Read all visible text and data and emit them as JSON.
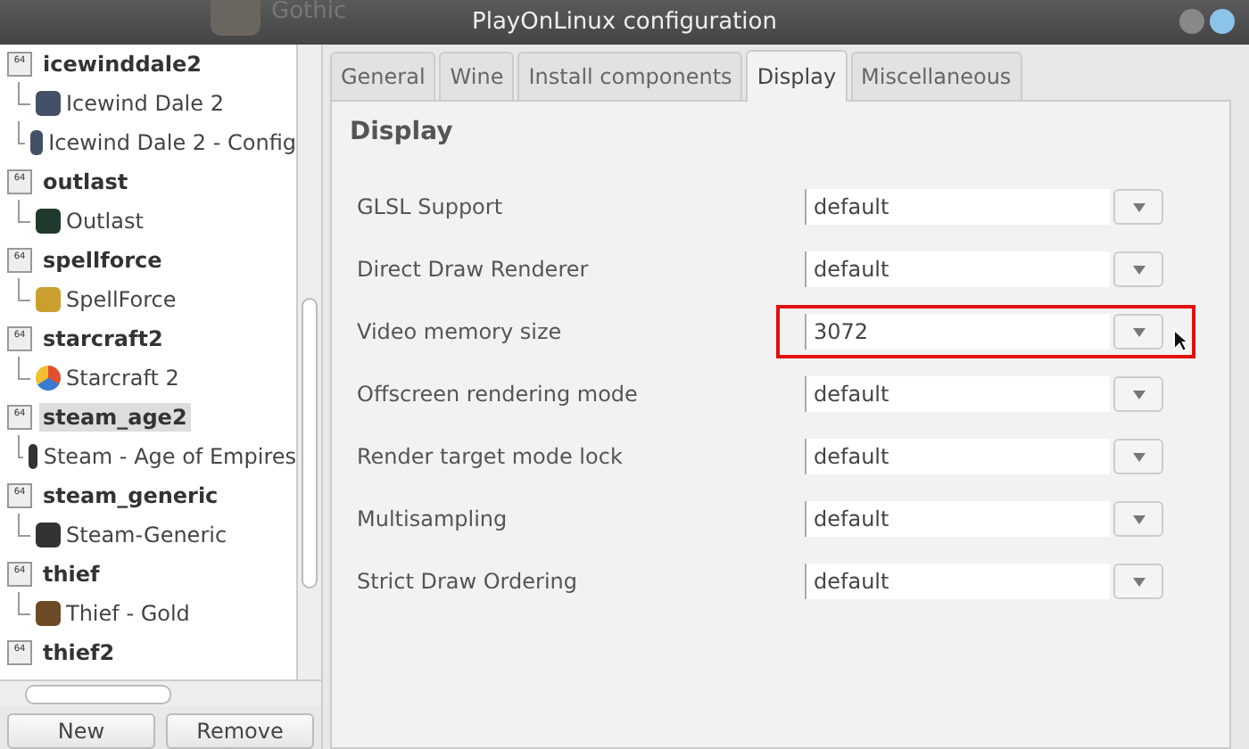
{
  "background_window": {
    "label": "Gothic"
  },
  "window": {
    "title": "PlayOnLinux configuration"
  },
  "tree": [
    {
      "label": "icewinddale2",
      "badge": "64",
      "selected": false,
      "children": [
        {
          "label": "Icewind Dale 2",
          "kind": "gear"
        },
        {
          "label": "Icewind Dale 2 - Config",
          "kind": "gear"
        }
      ]
    },
    {
      "label": "outlast",
      "badge": "64",
      "selected": false,
      "children": [
        {
          "label": "Outlast",
          "kind": "dark"
        }
      ]
    },
    {
      "label": "spellforce",
      "badge": "64",
      "selected": false,
      "children": [
        {
          "label": "SpellForce",
          "kind": "yellow"
        }
      ]
    },
    {
      "label": "starcraft2",
      "badge": "64",
      "selected": false,
      "children": [
        {
          "label": "Starcraft 2",
          "kind": "flower"
        }
      ]
    },
    {
      "label": "steam_age2",
      "badge": "64",
      "selected": true,
      "children": [
        {
          "label": "Steam - Age of Empires",
          "kind": "steam"
        }
      ]
    },
    {
      "label": "steam_generic",
      "badge": "64",
      "selected": false,
      "children": [
        {
          "label": "Steam-Generic",
          "kind": "steam"
        }
      ]
    },
    {
      "label": "thief",
      "badge": "64",
      "selected": false,
      "children": [
        {
          "label": "Thief - Gold",
          "kind": "brown"
        }
      ]
    },
    {
      "label": "thief2",
      "badge": "64",
      "selected": false
    }
  ],
  "buttons": [
    "New",
    "Remove"
  ],
  "tabs": [
    {
      "label": "General",
      "selected": false
    },
    {
      "label": "Wine",
      "selected": false
    },
    {
      "label": "Install components",
      "selected": false
    },
    {
      "label": "Display",
      "selected": true
    },
    {
      "label": "Miscellaneous",
      "selected": false
    }
  ],
  "panel": {
    "heading": "Display",
    "settings": [
      {
        "label": "GLSL Support",
        "value": "default",
        "highlighted": false
      },
      {
        "label": "Direct Draw Renderer",
        "value": "default",
        "highlighted": false
      },
      {
        "label": "Video memory size",
        "value": "3072",
        "highlighted": true
      },
      {
        "label": "Offscreen rendering mode",
        "value": "default",
        "highlighted": false
      },
      {
        "label": "Render target mode lock",
        "value": "default",
        "highlighted": false
      },
      {
        "label": "Multisampling",
        "value": "default",
        "highlighted": false
      },
      {
        "label": "Strict Draw Ordering",
        "value": "default",
        "highlighted": false
      }
    ]
  }
}
